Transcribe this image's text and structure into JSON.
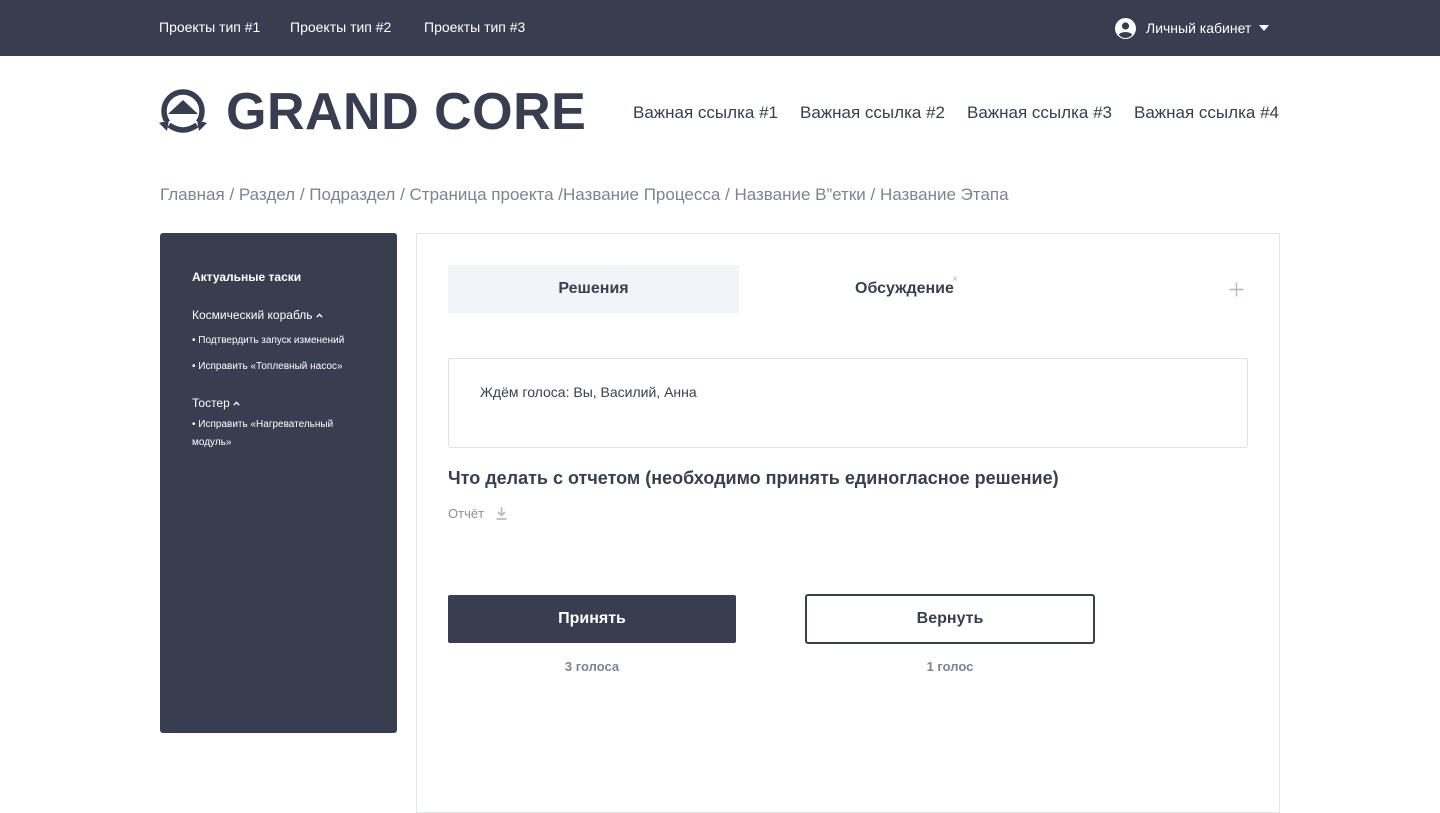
{
  "topbar": {
    "links": [
      "Проекты тип #1",
      "Проекты тип #2",
      "Проекты тип #3"
    ],
    "account_label": "Личный кабинет"
  },
  "header": {
    "brand": "GRAND CORE",
    "links": [
      "Важная ссылка #1",
      "Важная ссылка #2",
      "Важная ссылка #3",
      "Важная ссылка #4"
    ]
  },
  "breadcrumb": {
    "items": [
      "Главная",
      "Раздел",
      "Подраздел",
      "Страница проекта",
      "Название Процесса",
      "Название В”етки",
      "Название Этапа"
    ]
  },
  "sidebar": {
    "title": "Актуальные таски",
    "groups": [
      {
        "name": "Космический корабль",
        "items": [
          "• Подтвердить запуск изменений",
          "• Исправить «Топлевный насос»"
        ]
      },
      {
        "name": "Тостер",
        "items": [
          "• Исправить «Нагревательный модуль»"
        ]
      }
    ]
  },
  "tabs": {
    "active": "Решения",
    "second": "Обсуждение",
    "close_glyph": "×"
  },
  "main": {
    "status": "Ждём голоса: Вы, Василий, Анна",
    "question": "Что делать с отчетом (необходимо принять единогласное решение)",
    "report_label": "Отчёт",
    "accept_label": "Принять",
    "accept_votes": "3 голоса",
    "return_label": "Вернуть",
    "return_votes": "1 голос"
  },
  "colors": {
    "dark": "#383e50",
    "muted": "#7d8392",
    "tab_bg": "#f1f4f8"
  }
}
